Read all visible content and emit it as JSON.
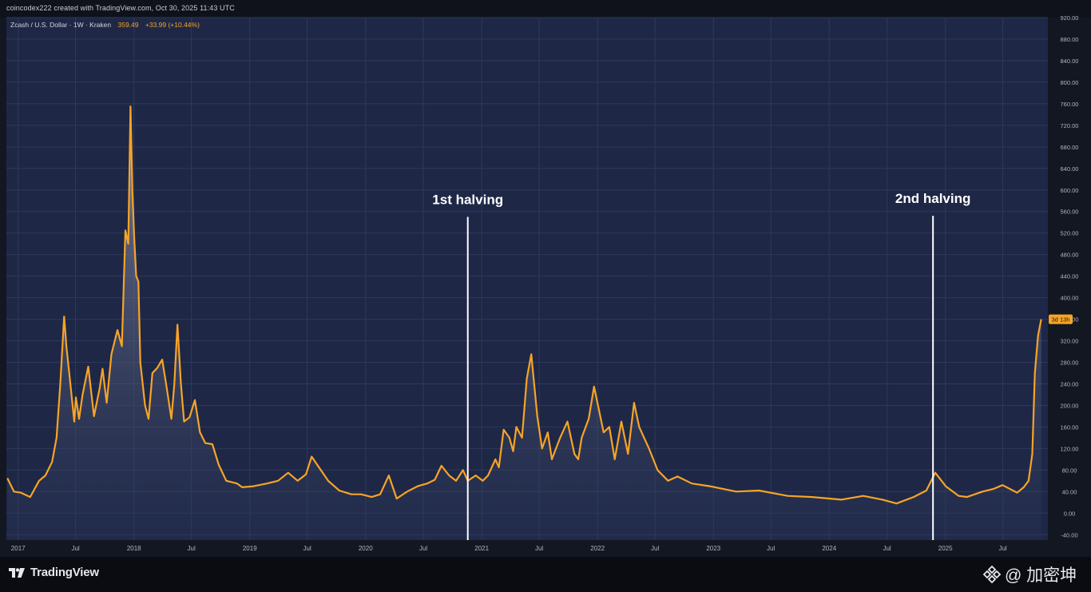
{
  "header": {
    "credit": "coincodex222 created with TradingView.com, Oct 30, 2025 11:43 UTC"
  },
  "legend": {
    "symbol": "Zcash / U.S. Dollar · 1W · Kraken",
    "price": "359.49",
    "change": "+33.99 (+10.44%)"
  },
  "price_badge": "3d 13h",
  "footer": {
    "brand": "TradingView",
    "watermark": "@ 加密坤"
  },
  "colors": {
    "background": "#1e2746",
    "line": "#f7a426",
    "annotation": "#ffffff",
    "grid": "#2d3a5c",
    "axis_text": "#b2b5be"
  },
  "icons": {
    "brand": "tradingview-logo-icon",
    "watermark": "binance-icon"
  },
  "chart_data": {
    "type": "area",
    "title": "Zcash / U.S. Dollar · 1W · Kraken",
    "xlabel": "",
    "ylabel": "",
    "ylim": [
      -50,
      920
    ],
    "grid": true,
    "y_ticks": [
      -40,
      0,
      40,
      80,
      120,
      160,
      200,
      240,
      280,
      320,
      360,
      400,
      440,
      480,
      520,
      560,
      600,
      640,
      680,
      720,
      760,
      800,
      840,
      880,
      920
    ],
    "y_tick_labels": [
      "-40.00",
      "0.00",
      "40.00",
      "80.00",
      "120.00",
      "160.00",
      "200.00",
      "240.00",
      "280.00",
      "320.00",
      "360.00",
      "400.00",
      "440.00",
      "480.00",
      "520.00",
      "560.00",
      "600.00",
      "640.00",
      "680.00",
      "720.00",
      "760.00",
      "800.00",
      "840.00",
      "880.00",
      "920.00"
    ],
    "x_ticks": [
      {
        "date": "2017-01-01",
        "label": "2017"
      },
      {
        "date": "2017-07-01",
        "label": "Jul"
      },
      {
        "date": "2018-01-01",
        "label": "2018"
      },
      {
        "date": "2018-07-01",
        "label": "Jul"
      },
      {
        "date": "2019-01-01",
        "label": "2019"
      },
      {
        "date": "2019-07-01",
        "label": "Jul"
      },
      {
        "date": "2020-01-01",
        "label": "2020"
      },
      {
        "date": "2020-07-01",
        "label": "Jul"
      },
      {
        "date": "2021-01-01",
        "label": "2021"
      },
      {
        "date": "2021-07-01",
        "label": "Jul"
      },
      {
        "date": "2022-01-01",
        "label": "2022"
      },
      {
        "date": "2022-07-01",
        "label": "Jul"
      },
      {
        "date": "2023-01-01",
        "label": "2023"
      },
      {
        "date": "2023-07-01",
        "label": "Jul"
      },
      {
        "date": "2024-01-01",
        "label": "2024"
      },
      {
        "date": "2024-07-01",
        "label": "Jul"
      },
      {
        "date": "2025-01-01",
        "label": "2025"
      },
      {
        "date": "2025-07-01",
        "label": "Jul"
      }
    ],
    "xlim": [
      "2016-11-25",
      "2025-11-20"
    ],
    "annotations": [
      {
        "date": "2020-11-18",
        "label": "1st halving",
        "y_top": 550
      },
      {
        "date": "2024-11-23",
        "label": "2nd halving",
        "y_top": 552
      }
    ],
    "series": [
      {
        "x": [
          "2016-11-28",
          "2016-12-19",
          "2017-01-10",
          "2017-02-08",
          "2017-03-08",
          "2017-03-28",
          "2017-04-18",
          "2017-05-02",
          "2017-05-14",
          "2017-05-26",
          "2017-06-02",
          "2017-06-11",
          "2017-06-27",
          "2017-07-02",
          "2017-07-12",
          "2017-07-23",
          "2017-08-10",
          "2017-08-28",
          "2017-09-15",
          "2017-09-24",
          "2017-10-07",
          "2017-10-22",
          "2017-11-10",
          "2017-11-24",
          "2017-12-05",
          "2017-12-14",
          "2017-12-21",
          "2017-12-27",
          "2018-01-02",
          "2018-01-08",
          "2018-01-15",
          "2018-01-21",
          "2018-02-05",
          "2018-02-16",
          "2018-02-28",
          "2018-03-16",
          "2018-03-31",
          "2018-04-15",
          "2018-04-29",
          "2018-05-08",
          "2018-05-18",
          "2018-05-29",
          "2018-06-08",
          "2018-06-25",
          "2018-07-12",
          "2018-07-28",
          "2018-08-14",
          "2018-09-05",
          "2018-09-25",
          "2018-10-19",
          "2018-11-22",
          "2018-12-08",
          "2019-01-13",
          "2019-02-24",
          "2019-03-31",
          "2019-05-02",
          "2019-06-01",
          "2019-06-27",
          "2019-07-15",
          "2019-08-13",
          "2019-09-05",
          "2019-10-10",
          "2019-11-17",
          "2019-12-18",
          "2020-01-20",
          "2020-02-16",
          "2020-03-14",
          "2020-04-08",
          "2020-05-11",
          "2020-06-13",
          "2020-07-13",
          "2020-08-06",
          "2020-08-27",
          "2020-09-20",
          "2020-10-12",
          "2020-11-03",
          "2020-11-18",
          "2020-12-13",
          "2021-01-04",
          "2021-01-21",
          "2021-02-13",
          "2021-02-24",
          "2021-03-11",
          "2021-03-29",
          "2021-04-10",
          "2021-04-20",
          "2021-05-08",
          "2021-05-23",
          "2021-06-06",
          "2021-06-25",
          "2021-07-10",
          "2021-07-28",
          "2021-08-10",
          "2021-09-05",
          "2021-09-28",
          "2021-10-20",
          "2021-11-01",
          "2021-11-12",
          "2021-12-04",
          "2021-12-21",
          "2022-01-20",
          "2022-02-07",
          "2022-02-24",
          "2022-03-17",
          "2022-04-07",
          "2022-04-26",
          "2022-05-12",
          "2022-06-12",
          "2022-07-09",
          "2022-08-11",
          "2022-09-10",
          "2022-10-25",
          "2022-12-21",
          "2023-03-14",
          "2023-05-25",
          "2023-08-23",
          "2023-11-08",
          "2024-02-08",
          "2024-04-17",
          "2024-06-17",
          "2024-07-31",
          "2024-09-23",
          "2024-11-02",
          "2024-11-30",
          "2025-01-02",
          "2025-02-12",
          "2025-03-10",
          "2025-04-28",
          "2025-06-02",
          "2025-06-30",
          "2025-08-15",
          "2025-09-05",
          "2025-09-20",
          "2025-10-02",
          "2025-10-10",
          "2025-10-20",
          "2025-10-30"
        ],
        "y": [
          65,
          40,
          38,
          30,
          60,
          70,
          95,
          140,
          240,
          365,
          310,
          260,
          170,
          215,
          175,
          220,
          272,
          180,
          232,
          268,
          205,
          295,
          340,
          310,
          525,
          500,
          755,
          600,
          510,
          440,
          430,
          280,
          200,
          175,
          260,
          270,
          285,
          230,
          175,
          238,
          350,
          240,
          170,
          178,
          210,
          150,
          130,
          128,
          90,
          60,
          55,
          48,
          50,
          55,
          60,
          75,
          60,
          72,
          105,
          80,
          60,
          42,
          35,
          35,
          30,
          35,
          70,
          27,
          40,
          50,
          55,
          62,
          88,
          70,
          60,
          80,
          60,
          70,
          60,
          70,
          100,
          85,
          155,
          140,
          115,
          160,
          140,
          250,
          295,
          180,
          120,
          150,
          100,
          140,
          170,
          110,
          100,
          140,
          175,
          235,
          150,
          160,
          100,
          170,
          110,
          205,
          160,
          120,
          80,
          60,
          68,
          55,
          50,
          40,
          42,
          32,
          30,
          25,
          32,
          25,
          18,
          30,
          42,
          75,
          50,
          32,
          30,
          40,
          45,
          52,
          38,
          48,
          60,
          110,
          260,
          330,
          360
        ],
        "labels": {
          "last_price": "359.49"
        }
      }
    ]
  }
}
